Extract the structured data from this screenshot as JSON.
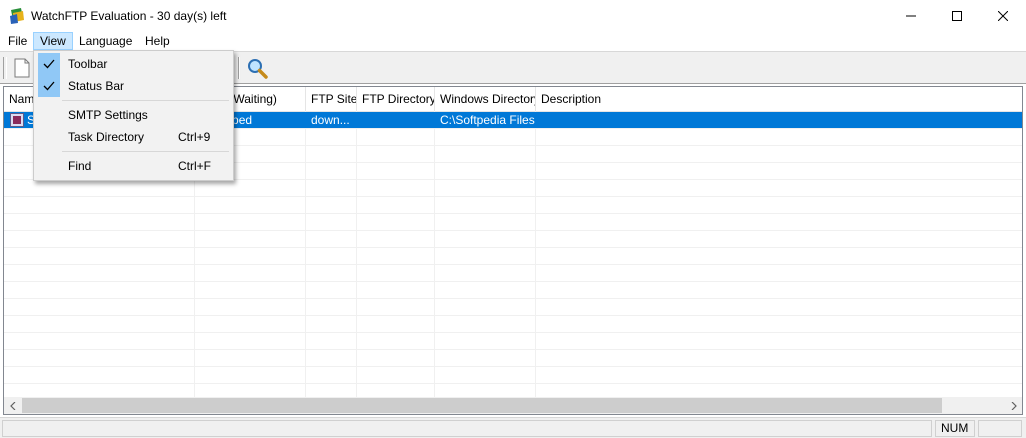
{
  "window": {
    "title": "WatchFTP Evaluation - 30 day(s) left"
  },
  "menubar": {
    "file": "File",
    "view": "View",
    "language": "Language",
    "help": "Help"
  },
  "view_menu": {
    "items": [
      {
        "label": "Toolbar",
        "checked": true,
        "shortcut": ""
      },
      {
        "label": "Status Bar",
        "checked": true,
        "shortcut": ""
      },
      {
        "label": "SMTP Settings",
        "checked": false,
        "shortcut": ""
      },
      {
        "label": "Task Directory",
        "checked": false,
        "shortcut": "Ctrl+9"
      },
      {
        "label": "Find",
        "checked": false,
        "shortcut": "Ctrl+F"
      }
    ]
  },
  "toolbar": {
    "icons": [
      "new-task-icon",
      "find-icon"
    ]
  },
  "task_list": {
    "columns": [
      "Name",
      "Downloads (Waiting)",
      "FTP Site",
      "FTP Directory",
      "Windows Directory",
      "Description"
    ],
    "visible_header_fragments": {
      "name": "Nam",
      "downloads": "oads (Waiting)"
    },
    "rows": [
      {
        "name": "S",
        "downloads": ") Stopped",
        "ftp_site": "down...",
        "ftp_directory": "",
        "windows_directory": "C:\\Softpedia Files",
        "description": ""
      }
    ]
  },
  "statusbar": {
    "num": "NUM"
  },
  "colors": {
    "selection": "#0078d7",
    "menu_highlight": "#cce8ff",
    "check_bg": "#90c8f6"
  }
}
